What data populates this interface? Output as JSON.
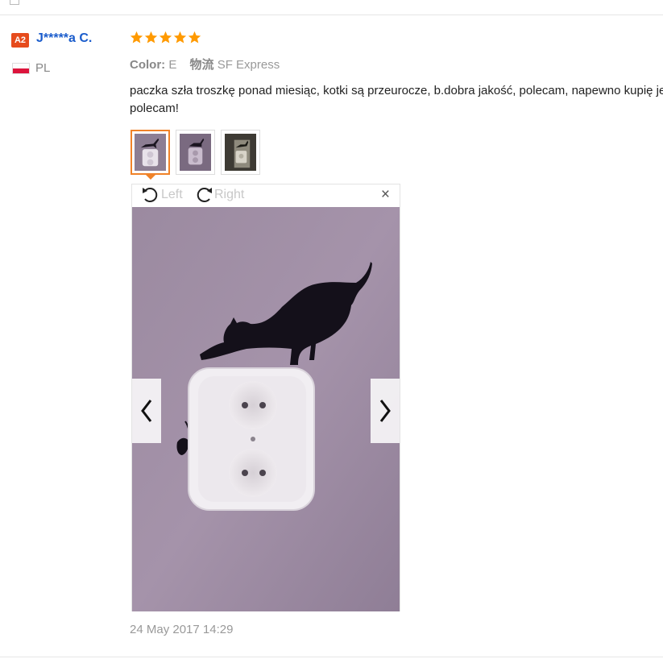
{
  "review": {
    "user": {
      "level_badge": "A2",
      "name": "J*****a C.",
      "country": "PL",
      "flag_colors": [
        "#ffffff",
        "#dc143c"
      ]
    },
    "rating": 5,
    "star_color": "#ff9a00",
    "sku": {
      "color_label": "Color:",
      "color_value": "E",
      "shipping_label": "物流",
      "shipping_value": "SF Express"
    },
    "text_lines": [
      "paczka szła troszkę ponad miesiąc, kotki są przeurocze, b.dobra jakość, polecam, napewno kupię jeszcze raz,",
      "polecam!"
    ],
    "thumbnails": [
      {
        "name": "photo-1",
        "active": true
      },
      {
        "name": "photo-2",
        "active": false
      },
      {
        "name": "photo-3",
        "active": false
      }
    ],
    "viewer": {
      "rotate_left_label": "Left",
      "rotate_right_label": "Right",
      "close_symbol": "×",
      "prev_icon": "chevron-left-icon",
      "next_icon": "chevron-right-icon"
    },
    "timestamp": "24 May 2017 14:29"
  },
  "colors": {
    "username": "#1a5ccc",
    "badge": "#e64b1c",
    "active_thumb_border": "#f08228"
  }
}
